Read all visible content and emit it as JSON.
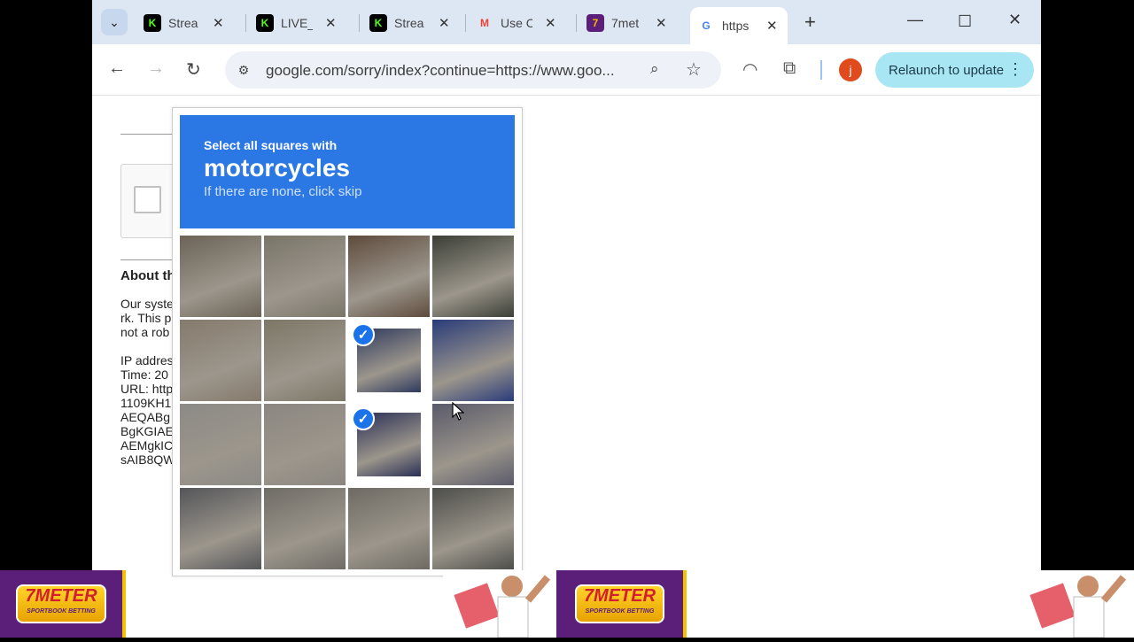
{
  "tabs": [
    {
      "title": "Strea",
      "icon": "kick-icon",
      "color": "#53fc18"
    },
    {
      "title": "LIVE_",
      "icon": "kick-icon",
      "color": "#53fc18"
    },
    {
      "title": "Strea",
      "icon": "kick-icon",
      "color": "#53fc18"
    },
    {
      "title": "Use C",
      "icon": "gmail-icon",
      "color": "#ea4335"
    },
    {
      "title": "7met",
      "icon": "7meter-icon",
      "color": "#f2b600"
    },
    {
      "title": "https",
      "icon": "google-icon",
      "color": "#4285f4",
      "active": true
    }
  ],
  "toolbar": {
    "url": "google.com/sorry/index?continue=https://www.goo...",
    "avatar_letter": "j",
    "relaunch_label": "Relaunch to update"
  },
  "page": {
    "about": "About th",
    "lines": [
      "Our syste",
      "rk. This p",
      "not a rob",
      "",
      "IP addres",
      "Time: 20",
      "URL: http",
      "1109KH1",
      "AEQABg",
      "BgKGIAE",
      "AEMgkIC",
      "sAIB8QW"
    ]
  },
  "captcha": {
    "instruction": "Select all squares with",
    "target": "motorcycles",
    "hint": "If there are none, click skip",
    "tiles": [
      {
        "selected": false,
        "color": "#6b6356"
      },
      {
        "selected": false,
        "color": "#7a7569"
      },
      {
        "selected": false,
        "color": "#5e4b3c"
      },
      {
        "selected": false,
        "color": "#3b3f36"
      },
      {
        "selected": false,
        "color": "#857a6c"
      },
      {
        "selected": false,
        "color": "#7d7767"
      },
      {
        "selected": true,
        "color": "#2f3a5e"
      },
      {
        "selected": false,
        "color": "#2a3c7a"
      },
      {
        "selected": false,
        "color": "#8c8a86"
      },
      {
        "selected": false,
        "color": "#8b8680"
      },
      {
        "selected": true,
        "color": "#2a2f55"
      },
      {
        "selected": false,
        "color": "#5a5a6a"
      },
      {
        "selected": false,
        "color": "#55565a"
      },
      {
        "selected": false,
        "color": "#6f6c66"
      },
      {
        "selected": false,
        "color": "#6e6a63"
      },
      {
        "selected": false,
        "color": "#4d4e4a"
      }
    ]
  },
  "ads": {
    "brand": "7METER",
    "tagline": "SPORTBOOK BETTING"
  }
}
